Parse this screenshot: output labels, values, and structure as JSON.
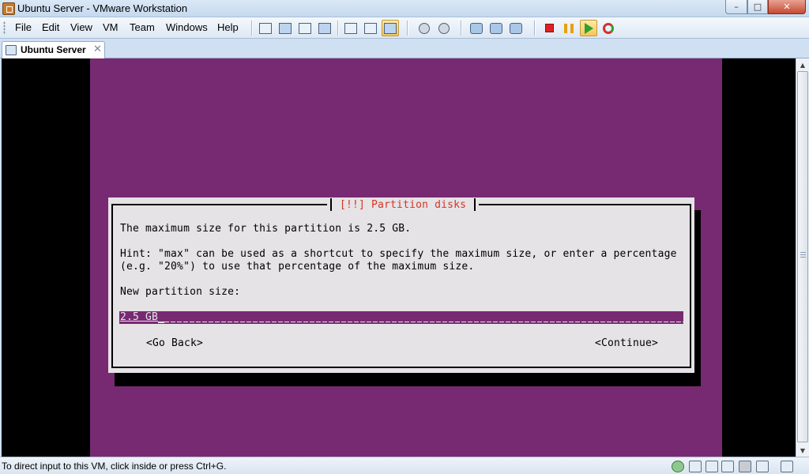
{
  "window": {
    "title": "Ubuntu Server - VMware Workstation",
    "controls": {
      "minimize": "–",
      "maximize": "□",
      "close": "✕"
    }
  },
  "menu": [
    "File",
    "Edit",
    "View",
    "VM",
    "Team",
    "Windows",
    "Help"
  ],
  "toolbar": {
    "view_icons": [
      "quick-switch-icon",
      "full-screen-icon",
      "fit-guest-icon",
      "unity-icon",
      "summary-view-icon",
      "console-view-icon",
      "thumbnail-view-icon"
    ],
    "snapshot_icons": [
      "take-snapshot-icon",
      "revert-snapshot-icon",
      "snapshot-manager-icon",
      "clone-icon",
      "team-icon"
    ],
    "power_icons": [
      "power-off-icon",
      "suspend-icon",
      "power-on-icon",
      "reset-icon"
    ],
    "colors": {
      "stop": "#e02020",
      "suspend": "#e8a010",
      "play": "#2ea02e"
    }
  },
  "tab": {
    "label": "Ubuntu Server",
    "close": "✕"
  },
  "vm": {
    "screen_color": "#772a72",
    "dialog": {
      "title": "[!!] Partition disks",
      "line1": "The maximum size for this partition is 2.5 GB.",
      "hint1": "Hint: \"max\" can be used as a shortcut to specify the maximum size, or enter a percentage",
      "hint2": "(e.g. \"20%\") to use that percentage of the maximum size.",
      "prompt": "New partition size:",
      "input_value": "2.5 GB",
      "go_back": "<Go Back>",
      "continue": "<Continue>"
    }
  },
  "status": {
    "text": "To direct input to this VM, click inside or press Ctrl+G.",
    "icons": [
      "network-icon",
      "printer-icon",
      "floppy-icon",
      "usb-icon",
      "cd-icon",
      "hard-disk-icon",
      "message-icon"
    ]
  }
}
